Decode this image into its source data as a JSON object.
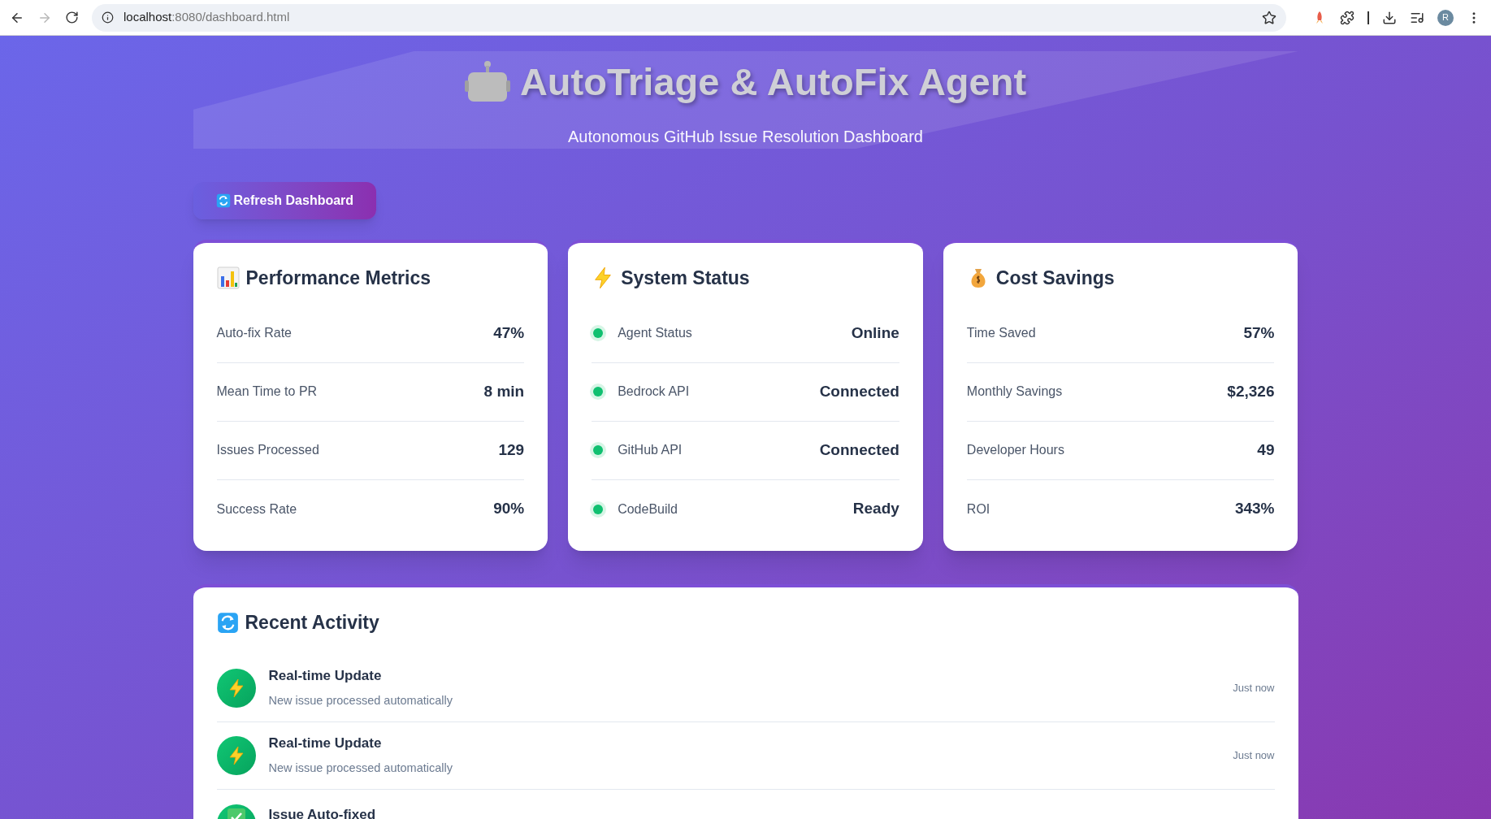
{
  "browser": {
    "url_host": "localhost",
    "url_path": ":8080/dashboard.html",
    "forward_disabled": true,
    "profile_initial": "R"
  },
  "header": {
    "title": "AutoTriage & AutoFix Agent",
    "subtitle": "Autonomous GitHub Issue Resolution Dashboard"
  },
  "refresh_button": {
    "label": "Refresh Dashboard"
  },
  "cards": [
    {
      "kind": "metrics",
      "title": "Performance Metrics",
      "rows": [
        {
          "label": "Auto-fix Rate",
          "value": "47%"
        },
        {
          "label": "Mean Time to PR",
          "value": "8 min"
        },
        {
          "label": "Issues Processed",
          "value": "129"
        },
        {
          "label": "Success Rate",
          "value": "90%"
        }
      ]
    },
    {
      "kind": "status",
      "title": "System Status",
      "rows": [
        {
          "label": "Agent Status",
          "value": "Online",
          "color": "#10c070"
        },
        {
          "label": "Bedrock API",
          "value": "Connected",
          "color": "#10c070"
        },
        {
          "label": "GitHub API",
          "value": "Connected",
          "color": "#10c070"
        },
        {
          "label": "CodeBuild",
          "value": "Ready",
          "color": "#10c070"
        }
      ]
    },
    {
      "kind": "savings",
      "title": "Cost Savings",
      "rows": [
        {
          "label": "Time Saved",
          "value": "57%"
        },
        {
          "label": "Monthly Savings",
          "value": "$2,326"
        },
        {
          "label": "Developer Hours",
          "value": "49"
        },
        {
          "label": "ROI",
          "value": "343%"
        }
      ]
    }
  ],
  "activity": {
    "title": "Recent Activity",
    "items": [
      {
        "kind": "update",
        "title": "Real-time Update",
        "description": "New issue processed automatically",
        "time": "Just now"
      },
      {
        "kind": "update",
        "title": "Real-time Update",
        "description": "New issue processed automatically",
        "time": "Just now"
      },
      {
        "kind": "fixed",
        "title": "Issue Auto-fixed"
      }
    ]
  }
}
